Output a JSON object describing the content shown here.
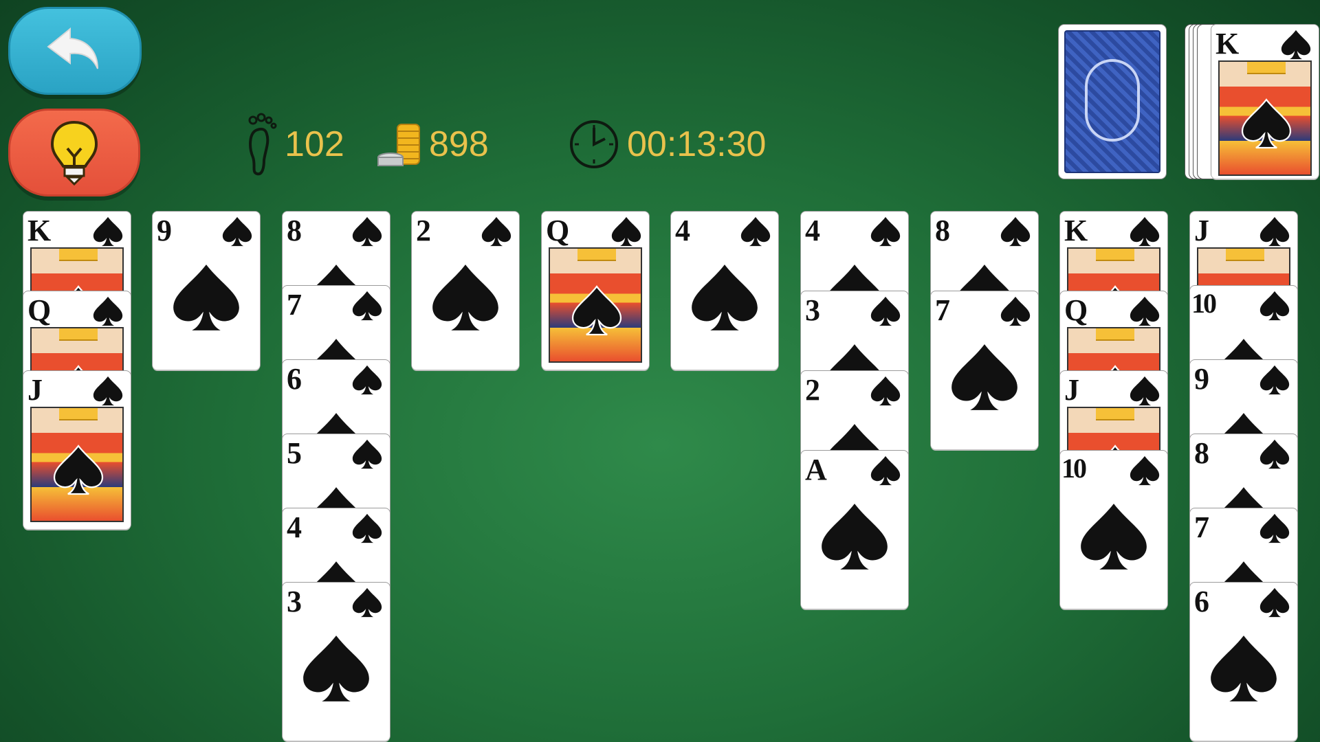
{
  "toolbar": {
    "undo_icon": "undo-arrow-icon",
    "hint_icon": "lightbulb-icon"
  },
  "stats": {
    "moves": "102",
    "coins": "898",
    "time": "00:13:30"
  },
  "colors": {
    "felt": "#1f6e38",
    "stat_text": "#e9c24c",
    "undo_button": "#2aa3c4",
    "hint_button": "#e4503a"
  },
  "foundation": {
    "top_card": "K"
  },
  "tableau": [
    [
      "K",
      "Q",
      "J"
    ],
    [
      "9"
    ],
    [
      "8",
      "7",
      "6",
      "5",
      "4",
      "3"
    ],
    [
      "2"
    ],
    [
      "Q"
    ],
    [
      "4"
    ],
    [
      "4",
      "3",
      "2",
      "A"
    ],
    [
      "8",
      "7"
    ],
    [
      "K",
      "Q",
      "J",
      "10"
    ],
    [
      "J",
      "10",
      "9",
      "8",
      "7",
      "6"
    ]
  ]
}
